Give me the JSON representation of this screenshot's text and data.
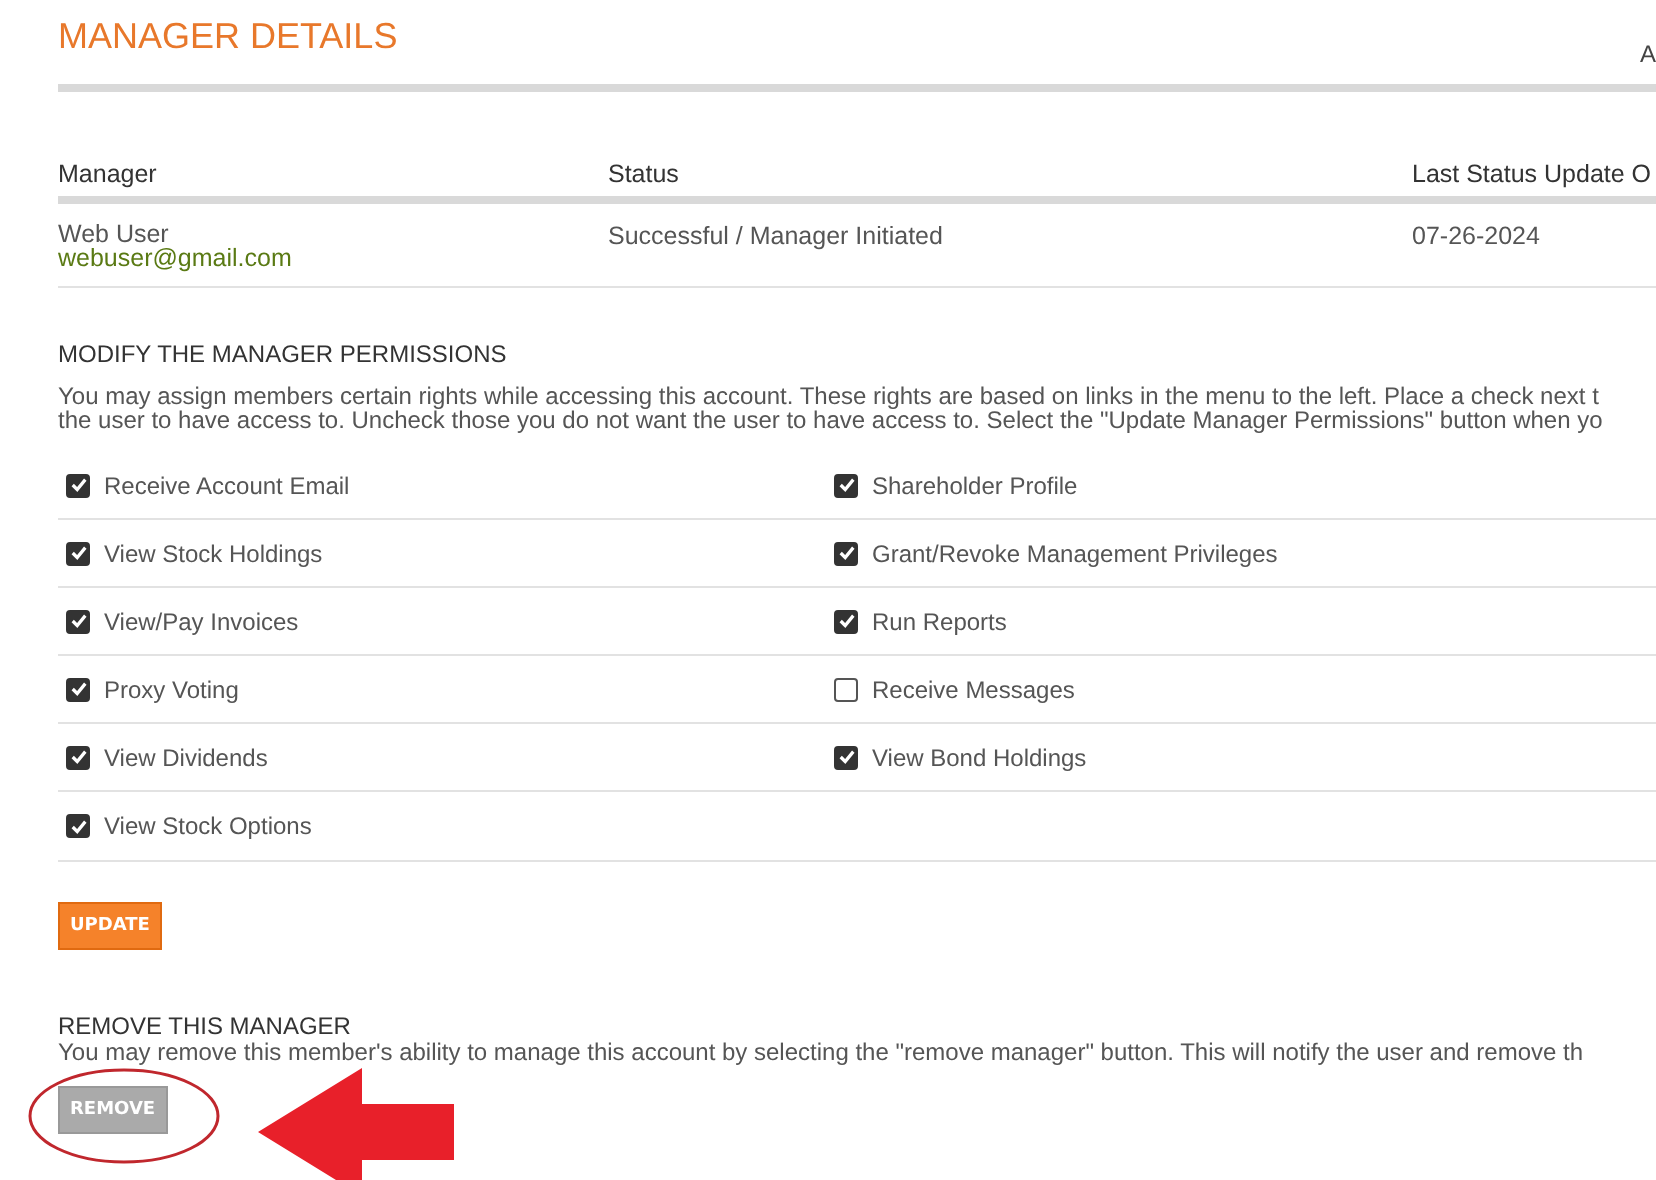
{
  "title": "MANAGER DETAILS",
  "corner_text": "A",
  "table": {
    "columns": [
      "Manager",
      "Status",
      "Last Status Update O"
    ],
    "rows": [
      {
        "name": "Web User",
        "email": "webuser@gmail.com",
        "status": "Successful / Manager Initiated",
        "date": "07-26-2024"
      }
    ]
  },
  "permissions": {
    "heading": "MODIFY THE MANAGER PERMISSIONS",
    "description_lines": [
      "You may assign members certain rights while accessing this account. These rights are based on links in the menu to the left. Place a check next t",
      "the user to have access to. Uncheck those you do not want the user to have access to. Select the \"Update Manager Permissions\" button when yo"
    ],
    "rows": [
      [
        {
          "label": "Receive Account Email",
          "checked": true
        },
        {
          "label": "Shareholder Profile",
          "checked": true
        }
      ],
      [
        {
          "label": "View Stock Holdings",
          "checked": true
        },
        {
          "label": "Grant/Revoke Management Privileges",
          "checked": true
        }
      ],
      [
        {
          "label": "View/Pay Invoices",
          "checked": true
        },
        {
          "label": "Run Reports",
          "checked": true
        }
      ],
      [
        {
          "label": "Proxy Voting",
          "checked": true
        },
        {
          "label": "Receive Messages",
          "checked": false
        }
      ],
      [
        {
          "label": "View Dividends",
          "checked": true
        },
        {
          "label": "View Bond Holdings",
          "checked": true
        }
      ],
      [
        {
          "label": "View Stock Options",
          "checked": true
        }
      ]
    ],
    "button": "UPDATE"
  },
  "remove": {
    "heading": "REMOVE THIS MANAGER",
    "description": "You may remove this member's ability to manage this account by selecting the \"remove manager\" button. This will notify the user and remove th",
    "button": "REMOVE"
  }
}
